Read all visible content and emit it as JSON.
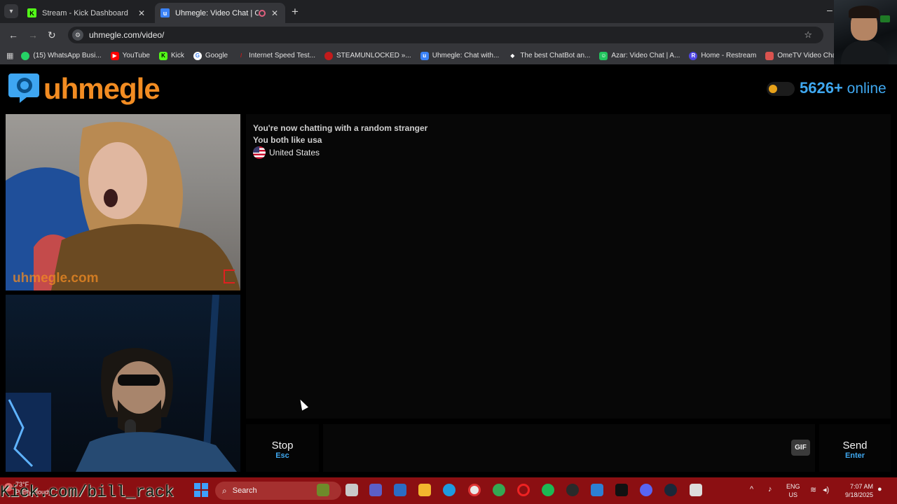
{
  "browser": {
    "tabs": [
      {
        "title": "Stream - Kick Dashboard",
        "favicon_color": "#53fc18",
        "active": false
      },
      {
        "title": "Uhmegle: Video Chat | Ome",
        "favicon_color": "#3b82f6",
        "active": true
      }
    ],
    "url": "uhmegle.com/video/",
    "bookmarks": [
      {
        "label": "(15) WhatsApp Busi...",
        "icon_color": "#25d366"
      },
      {
        "label": "YouTube",
        "icon_color": "#ff0000"
      },
      {
        "label": "Kick",
        "icon_color": "#53fc18"
      },
      {
        "label": "Google",
        "icon_color": "#4285f4"
      },
      {
        "label": "Internet Speed Test...",
        "icon_color": "#c21b1b"
      },
      {
        "label": "STEAMUNLOCKED »...",
        "icon_color": "#c21b1b"
      },
      {
        "label": "Uhmegle: Chat with...",
        "icon_color": "#3b82f6"
      },
      {
        "label": "The best ChatBot an...",
        "icon_color": "#ffffff"
      },
      {
        "label": "Azar: Video Chat | A...",
        "icon_color": "#22c55e"
      },
      {
        "label": "Home - Restream",
        "icon_color": "#4f46e5"
      },
      {
        "label": "OmeTV Video Chat...",
        "icon_color": "#d9534f"
      }
    ]
  },
  "header": {
    "logo_text": "uhmegle",
    "online_count": "5626+",
    "online_label": "online"
  },
  "stranger_video": {
    "watermark": "uhmegle.com"
  },
  "chat": {
    "messages": [
      "You're now chatting with a random stranger",
      "You both like usa"
    ],
    "country": "United States"
  },
  "controls": {
    "stop_label": "Stop",
    "stop_key": "Esc",
    "gif_label": "GIF",
    "send_label": "Send",
    "send_key": "Enter",
    "message_placeholder": ""
  },
  "taskbar": {
    "weather_temp": "73°F",
    "weather_desc": "Partly cloudy",
    "search_label": "Search",
    "lang_primary": "ENG",
    "lang_secondary": "US",
    "time": "7:07 AM",
    "date": "9/18/2025"
  },
  "overlay": {
    "stream_url": "Kick.com/bill_rack"
  },
  "colors": {
    "brand_orange": "#f28c22",
    "accent_blue": "#3fa8f0",
    "taskbar_red": "#8b0f12"
  }
}
